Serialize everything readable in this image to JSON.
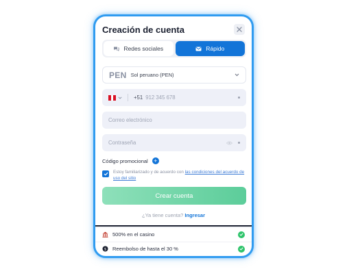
{
  "modal": {
    "title": "Creación de cuenta",
    "tabs": [
      {
        "label": "Redes sociales"
      },
      {
        "label": "Rápido"
      }
    ],
    "currency": {
      "code": "PEN",
      "name": "Sol peruano (PEN)"
    },
    "phone": {
      "prefix": "+51",
      "placeholder": "912 345 678"
    },
    "email": {
      "placeholder": "Correo electrónico"
    },
    "password": {
      "placeholder": "Contraseña"
    },
    "promo_label": "Código promocional",
    "agree_text": "Estoy familiarizado y de acuerdo con",
    "agree_link": "las condiciones del acuerdo de uso del sitio",
    "create_button": "Crear cuenta",
    "login_prompt": "¿Ya tiene cuenta?",
    "login_link": "Ingresar",
    "bonuses": [
      {
        "label": "500% en el casino"
      },
      {
        "label": "Reembolso de hasta el 30 %"
      }
    ]
  },
  "colors": {
    "accent": "#1274d8",
    "frame": "#2f9bf0",
    "create_button": "#5ccd9a",
    "success": "#2ec46b"
  }
}
